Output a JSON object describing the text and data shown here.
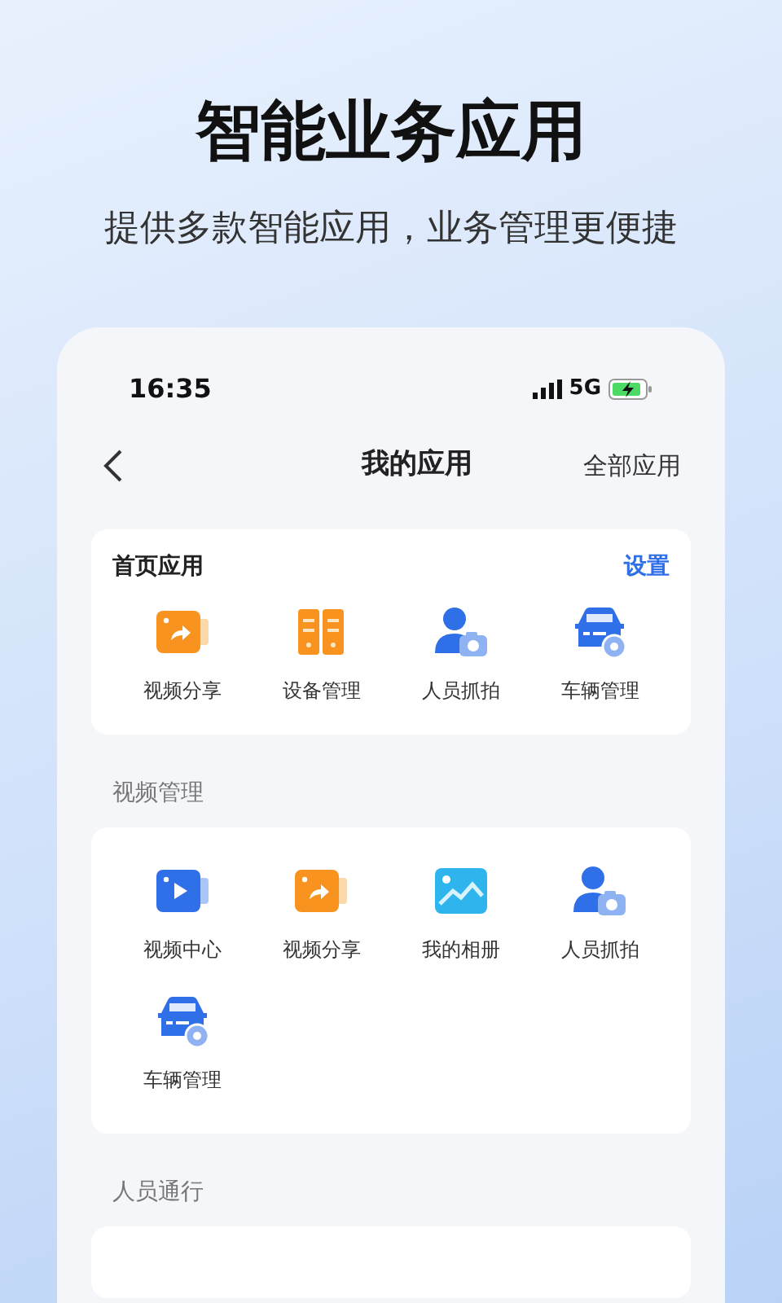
{
  "headline": "智能业务应用",
  "subtitle": "提供多款智能应用，业务管理更便捷",
  "status_bar": {
    "time": "16:35",
    "network": "5G"
  },
  "nav": {
    "title": "我的应用",
    "action": "全部应用"
  },
  "home_apps": {
    "title": "首页应用",
    "action": "设置",
    "items": [
      {
        "label": "视频分享",
        "kind": "share"
      },
      {
        "label": "设备管理",
        "kind": "device"
      },
      {
        "label": "人员抓拍",
        "kind": "person"
      },
      {
        "label": "车辆管理",
        "kind": "car"
      }
    ]
  },
  "sections": [
    {
      "title": "视频管理",
      "items": [
        {
          "label": "视频中心",
          "kind": "play"
        },
        {
          "label": "视频分享",
          "kind": "share"
        },
        {
          "label": "我的相册",
          "kind": "album"
        },
        {
          "label": "人员抓拍",
          "kind": "person"
        },
        {
          "label": "车辆管理",
          "kind": "car"
        }
      ]
    },
    {
      "title": "人员通行"
    }
  ]
}
